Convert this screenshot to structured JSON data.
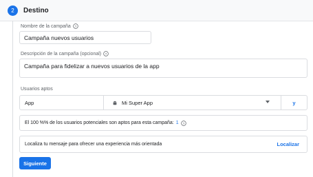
{
  "step": {
    "number": "2",
    "title": "Destino"
  },
  "campaign_name": {
    "label": "Nombre de la campaña",
    "value": "Campaña nuevos usuarios"
  },
  "campaign_description": {
    "label": "Descripción de la campaña (opcional)",
    "value": "Campaña para fidelizar a nuevos usuarios de la app"
  },
  "eligible_users": {
    "label": "Usuarios aptos",
    "platform": "App",
    "app_name": "Mi Super App",
    "and_label": "y",
    "info_text": "El 100 %% de los usuarios potenciales son aptos para esta campaña:",
    "info_count": "1"
  },
  "localize": {
    "text": "Localiza tu mensaje para ofrecer una experiencia más orientada",
    "link": "Localizar"
  },
  "next_button": "Siguiente",
  "colors": {
    "accent": "#1a73e8",
    "border": "#dadce0",
    "header_bg": "#f8f9fa"
  },
  "icons": {
    "help": "help-circle-icon",
    "app": "android-app-icon",
    "dropdown": "chevron-down-icon"
  }
}
